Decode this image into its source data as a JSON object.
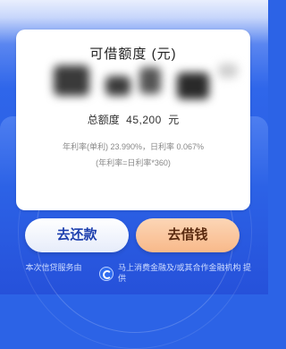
{
  "card": {
    "title": "可借额度 (元)",
    "total_label": "总额度",
    "total_value": "45,200",
    "total_unit": "元",
    "annual_rate": "年利率(单利) 23.990%，日利率 0.067%",
    "rate_formula": "(年利率=日利率*360)"
  },
  "buttons": {
    "repay": "去还款",
    "borrow": "去借钱"
  },
  "footer": {
    "left": "本次信贷服务由",
    "right": "马上消费金融及/或其合作金融机构 提供",
    "logo_icon": "provider-logo-icon"
  },
  "colors": {
    "primary_blue": "#2c63e6",
    "borrow_button": "#f8b98a",
    "repay_text": "#1d3fae"
  }
}
